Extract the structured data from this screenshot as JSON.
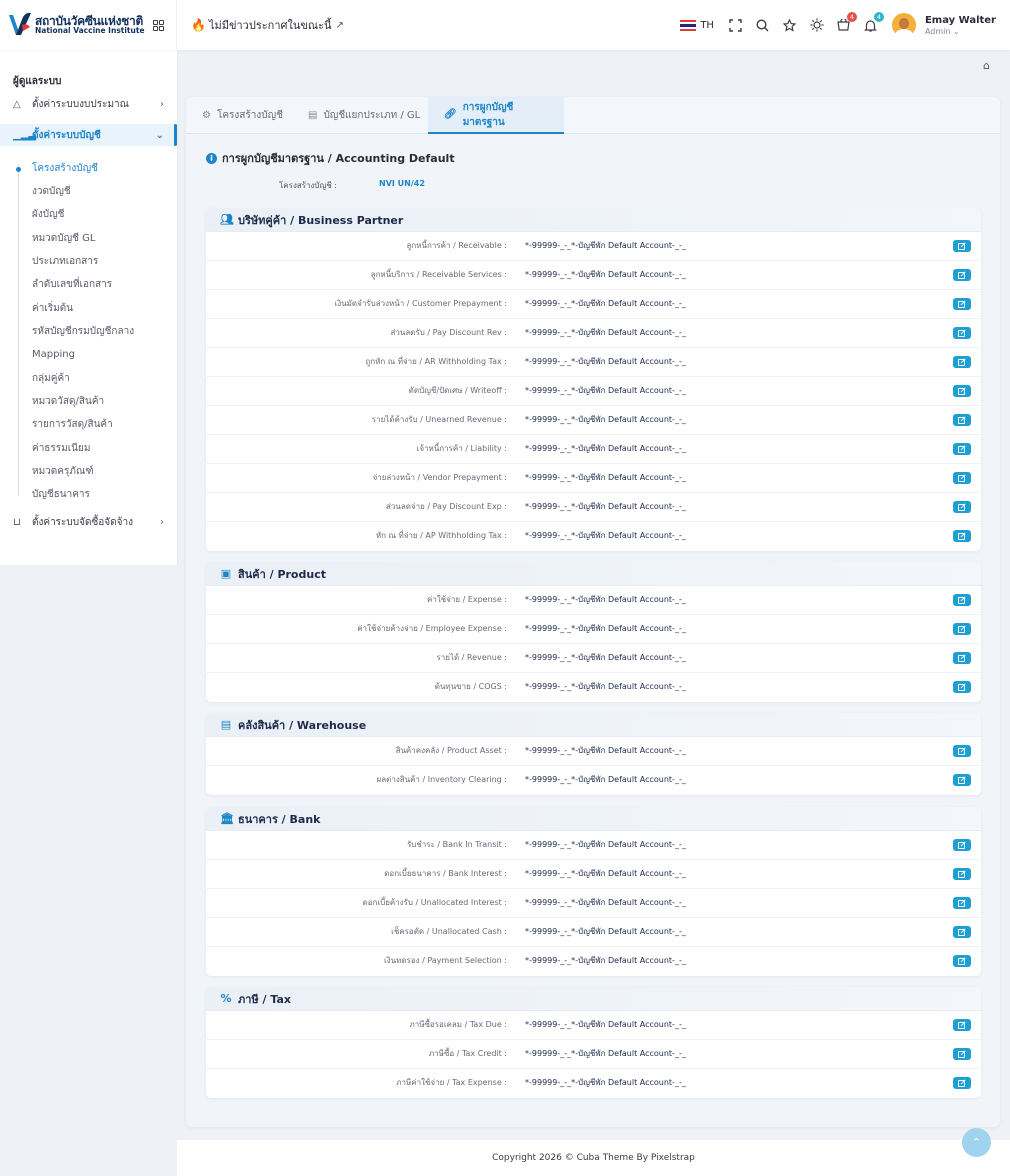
{
  "header": {
    "logo_th": "สถาบันวัคซีนแห่งชาติ",
    "logo_en": "National Vaccine Institute",
    "news": "ไม่มีข่าวประกาศในขณะนี้",
    "lang": "TH",
    "cart_badge": "4",
    "bell_badge": "4",
    "user_name": "Emay Walter",
    "user_role": "Admin"
  },
  "sidebar": {
    "heading": "ผู้ดูแลระบบ",
    "items": [
      {
        "label": "ตั้งค่าระบบงบประมาณ"
      },
      {
        "label": "ตั้งค่าระบบบัญชี"
      },
      {
        "label": "ตั้งค่าระบบจัดซื้อจัดจ้าง"
      }
    ],
    "sub": [
      "โครงสร้างบัญชี",
      "งวดบัญชี",
      "ผังบัญชี",
      "หมวดบัญชี GL",
      "ประเภทเอกสาร",
      "ลำดับเลขที่เอกสาร",
      "ค่าเริ่มต้น",
      "รหัสบัญชีกรมบัญชีกลาง",
      "Mapping",
      "กลุ่มคู่ค้า",
      "หมวดวัสดุ/สินค้า",
      "รายการวัสดุ/สินค้า",
      "ค่าธรรมเนียม",
      "หมวดครุภัณฑ์",
      "บัญชีธนาคาร"
    ]
  },
  "tabs": [
    {
      "label": "โครงสร้างบัญชี"
    },
    {
      "label": "บัญชีแยกประเภท / GL"
    },
    {
      "label": "การผูกบัญชีมาตรฐาน"
    }
  ],
  "section": {
    "title": "การผูกบัญชีมาตรฐาน / Accounting Default",
    "struct_label": "โครงสร้างบัญชี :",
    "struct_value": "NVI UN/42"
  },
  "groups": [
    {
      "title": "บริษัทคู่ค้า / Business Partner",
      "rows": [
        {
          "label": "ลูกหนี้การค้า / Receivable :",
          "value": "*-99999-_-_*-บัญชีพัก Default Account-_-_"
        },
        {
          "label": "ลูกหนี้บริการ / Receivable Services :",
          "value": "*-99999-_-_*-บัญชีพัก Default Account-_-_"
        },
        {
          "label": "เงินมัดจำรับล่วงหน้า / Customer Prepayment :",
          "value": "*-99999-_-_*-บัญชีพัก Default Account-_-_"
        },
        {
          "label": "ส่วนลดรับ / Pay Discount Rev :",
          "value": "*-99999-_-_*-บัญชีพัก Default Account-_-_"
        },
        {
          "label": "ถูกหัก ณ ที่จ่าย / AR Withholding Tax :",
          "value": "*-99999-_-_*-บัญชีพัก Default Account-_-_"
        },
        {
          "label": "ตัดบัญชี/ปัดเศษ / Writeoff :",
          "value": "*-99999-_-_*-บัญชีพัก Default Account-_-_"
        },
        {
          "label": "รายได้ค้างรับ / Unearned Revenue :",
          "value": "*-99999-_-_*-บัญชีพัก Default Account-_-_"
        },
        {
          "label": "เจ้าหนี้การค้า / Liability :",
          "value": "*-99999-_-_*-บัญชีพัก Default Account-_-_"
        },
        {
          "label": "จ่ายล่วงหน้า / Vendor Prepayment :",
          "value": "*-99999-_-_*-บัญชีพัก Default Account-_-_"
        },
        {
          "label": "ส่วนลดจ่าย / Pay Discount Exp :",
          "value": "*-99999-_-_*-บัญชีพัก Default Account-_-_"
        },
        {
          "label": "หัก ณ ที่จ่าย / AP Withholding Tax :",
          "value": "*-99999-_-_*-บัญชีพัก Default Account-_-_"
        }
      ]
    },
    {
      "title": "สินค้า / Product",
      "rows": [
        {
          "label": "ค่าใช้จ่าย / Expense :",
          "value": "*-99999-_-_*-บัญชีพัก Default Account-_-_"
        },
        {
          "label": "ค่าใช้จ่ายค้างจ่าย / Employee Expense :",
          "value": "*-99999-_-_*-บัญชีพัก Default Account-_-_"
        },
        {
          "label": "รายได้ / Revenue :",
          "value": "*-99999-_-_*-บัญชีพัก Default Account-_-_"
        },
        {
          "label": "ต้นทุนขาย / COGS :",
          "value": "*-99999-_-_*-บัญชีพัก Default Account-_-_"
        }
      ]
    },
    {
      "title": "คลังสินค้า / Warehouse",
      "rows": [
        {
          "label": "สินค้าคงคลัง / Product Asset :",
          "value": "*-99999-_-_*-บัญชีพัก Default Account-_-_"
        },
        {
          "label": "ผลต่างสินค้า / Inventory Clearing :",
          "value": "*-99999-_-_*-บัญชีพัก Default Account-_-_"
        }
      ]
    },
    {
      "title": "ธนาคาร / Bank",
      "rows": [
        {
          "label": "รับชำระ / Bank In Transit :",
          "value": "*-99999-_-_*-บัญชีพัก Default Account-_-_"
        },
        {
          "label": "ดอกเบี้ยธนาคาร / Bank Interest :",
          "value": "*-99999-_-_*-บัญชีพัก Default Account-_-_"
        },
        {
          "label": "ดอกเบี้ยค้างรับ / Unallocated Interest :",
          "value": "*-99999-_-_*-บัญชีพัก Default Account-_-_"
        },
        {
          "label": "เช็ครอตัด / Unallocated Cash :",
          "value": "*-99999-_-_*-บัญชีพัก Default Account-_-_"
        },
        {
          "label": "เงินทดรอง / Payment Selection :",
          "value": "*-99999-_-_*-บัญชีพัก Default Account-_-_"
        }
      ]
    },
    {
      "title": "ภาษี / Tax",
      "rows": [
        {
          "label": "ภาษีซื้อรอเคลม / Tax Due :",
          "value": "*-99999-_-_*-บัญชีพัก Default Account-_-_"
        },
        {
          "label": "ภาษีซื้อ / Tax Credit :",
          "value": "*-99999-_-_*-บัญชีพัก Default Account-_-_"
        },
        {
          "label": "ภาษีค่าใช้จ่าย / Tax Expense :",
          "value": "*-99999-_-_*-บัญชีพัก Default Account-_-_"
        }
      ]
    }
  ],
  "footer": "Copyright 2026 © Cuba Theme By Pixelstrap",
  "colors": {
    "accent": "#1d86c8",
    "edit_button": "#1d9fd4",
    "brand_navy": "#12325e"
  }
}
